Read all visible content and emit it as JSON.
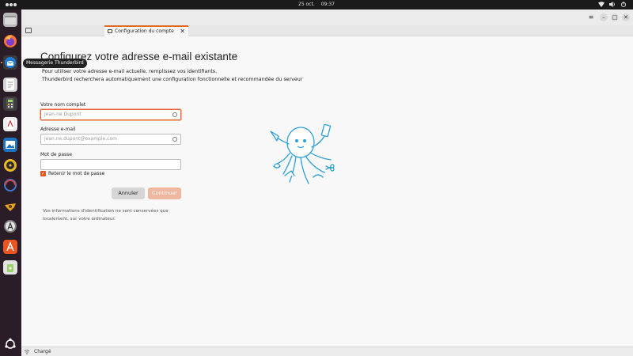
{
  "topbar": {
    "date": "25 oct.",
    "time": "09:37",
    "tray_icons": [
      "wifi-icon",
      "volume-icon",
      "power-icon"
    ]
  },
  "dock": {
    "items": [
      "files-icon",
      "firefox-icon",
      "thunderbird-icon",
      "text-editor-icon",
      "calculator-icon",
      "document-viewer-icon",
      "image-viewer-icon",
      "rhythmbox-icon",
      "settings-icon",
      "backup-icon",
      "software-updater-icon",
      "app-center-icon",
      "trash-icon",
      "show-apps-icon"
    ],
    "tooltip": "Messagerie Thunderbird"
  },
  "window": {
    "tab_label": "Configuration du compte",
    "tab_close": "✕"
  },
  "content": {
    "heading": "Configurez votre adresse e-mail existante",
    "intro_line1": "Pour utiliser votre adresse e-mail actuelle, remplissez vos identifiants.",
    "intro_line2": "Thunderbird recherchera automatiquement une configuration fonctionnelle et recommandée du serveur",
    "name_label": "Votre nom complet",
    "name_placeholder": "Jean-ne Dupont",
    "email_label": "Adresse e-mail",
    "email_placeholder": "jean.ne.dupont@example.com",
    "password_label": "Mot de passe",
    "password_value": "",
    "remember_label": "Retenir le mot de passe",
    "remember_checked": true,
    "cancel_label": "Annuler",
    "continue_label": "Continuer",
    "note_line1": "Vos informations d'identification ne sont conservées que",
    "note_line2": "localement, sur votre ordinateur."
  },
  "status": {
    "text": "Chargé"
  },
  "colors": {
    "accent": "#e2571f",
    "continue_disabled": "#efb6a0",
    "mascot": "#2b9fd9"
  }
}
